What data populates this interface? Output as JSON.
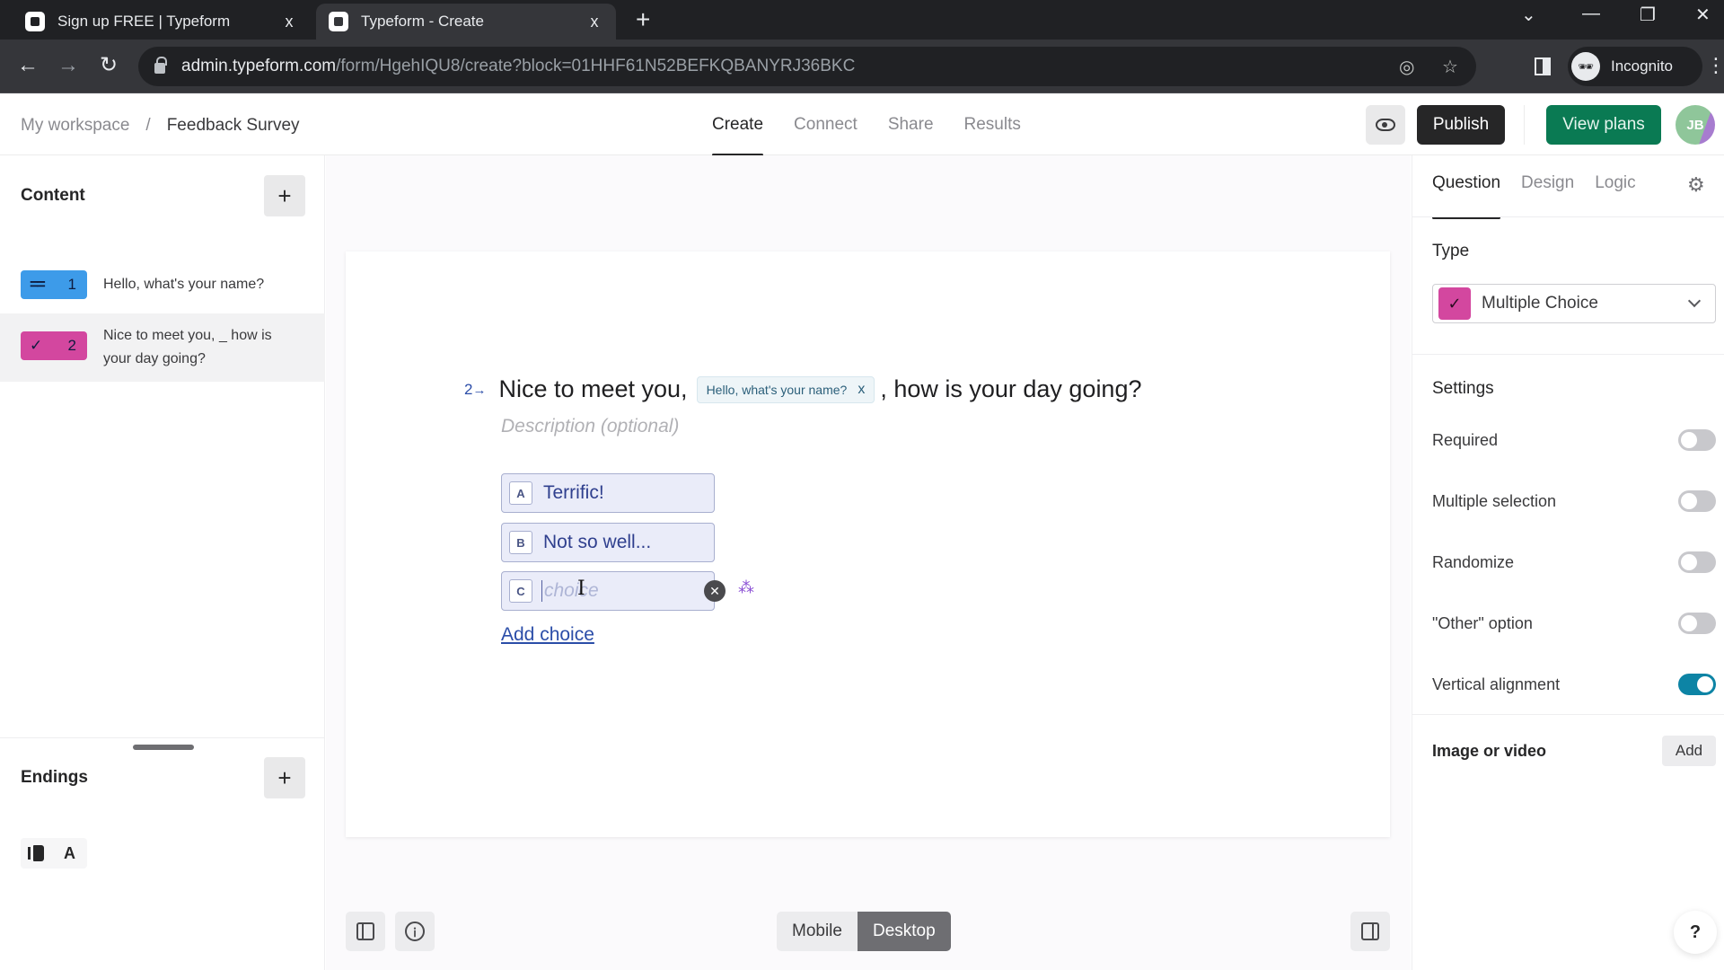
{
  "browser": {
    "tabs": [
      {
        "title": "Sign up FREE | Typeform",
        "active": false
      },
      {
        "title": "Typeform - Create",
        "active": true
      }
    ],
    "close_glyph": "x",
    "new_tab_glyph": "+",
    "url_host": "admin.typeform.com",
    "url_path": "/form/HgehIQU8/create?block=01HHF61N52BEFKQBANYRJ36BKC",
    "profile_label": "Incognito",
    "icons": {
      "back": "←",
      "forward": "→",
      "reload": "↻",
      "eye_off": "◎",
      "star": "☆",
      "kebab": "⋮",
      "tab_search": "⌄",
      "minimize": "—",
      "restore": "❐",
      "close": "✕",
      "incognito": "🕶"
    }
  },
  "header": {
    "breadcrumb": {
      "workspace": "My workspace",
      "separator": "/",
      "form": "Feedback Survey"
    },
    "tabs": [
      {
        "label": "Create",
        "active": true
      },
      {
        "label": "Connect",
        "active": false
      },
      {
        "label": "Share",
        "active": false
      },
      {
        "label": "Results",
        "active": false
      }
    ],
    "publish_label": "Publish",
    "view_plans_label": "View plans",
    "avatar_initials": "JB",
    "colors": {
      "publish": "#262627",
      "view_plans": "#0a7a53"
    }
  },
  "sidebar": {
    "content_title": "Content",
    "add_glyph": "+",
    "questions": [
      {
        "number": "1",
        "icon": "short-text-icon",
        "glyph": "==",
        "color": "#3d9be9",
        "text": "Hello, what's your name?",
        "selected": false
      },
      {
        "number": "2",
        "icon": "checkmark-icon",
        "glyph": "✓",
        "color": "#d3479f",
        "text": "Nice to meet you, _ how is your day going?",
        "selected": true
      }
    ],
    "endings_title": "Endings",
    "endings": [
      {
        "label": "A"
      }
    ]
  },
  "editor": {
    "question_number": "2",
    "question_arrow": "→",
    "title_before": "Nice to meet you,",
    "recall_chip": "Hello, what's your name?",
    "recall_remove": "x",
    "title_after": ", how is your day going?",
    "description_placeholder": "Description (optional)",
    "choices": [
      {
        "key": "A",
        "label": "Terrific!"
      },
      {
        "key": "B",
        "label": "Not so well..."
      },
      {
        "key": "C",
        "label": "",
        "placeholder": "choice",
        "editing": true
      }
    ],
    "remove_glyph": "✕",
    "sparkle_glyph": "⁂",
    "add_choice_label": "Add choice",
    "device_options": [
      {
        "label": "Mobile",
        "active": false
      },
      {
        "label": "Desktop",
        "active": true
      }
    ],
    "accessibility_glyph": "♿"
  },
  "right_panel": {
    "tabs": [
      {
        "label": "Question",
        "active": true
      },
      {
        "label": "Design",
        "active": false
      },
      {
        "label": "Logic",
        "active": false
      }
    ],
    "gear_glyph": "⚙",
    "type_label": "Type",
    "type_value": "Multiple Choice",
    "type_color": "#d3479f",
    "settings_title": "Settings",
    "settings": [
      {
        "label": "Required",
        "on": false
      },
      {
        "label": "Multiple selection",
        "on": false
      },
      {
        "label": "Randomize",
        "on": false
      },
      {
        "label": "\"Other\" option",
        "on": false
      },
      {
        "label": "Vertical alignment",
        "on": true
      }
    ],
    "toggle_on_color": "#0d84a5",
    "media_label": "Image or video",
    "media_add_label": "Add"
  },
  "help_glyph": "?"
}
